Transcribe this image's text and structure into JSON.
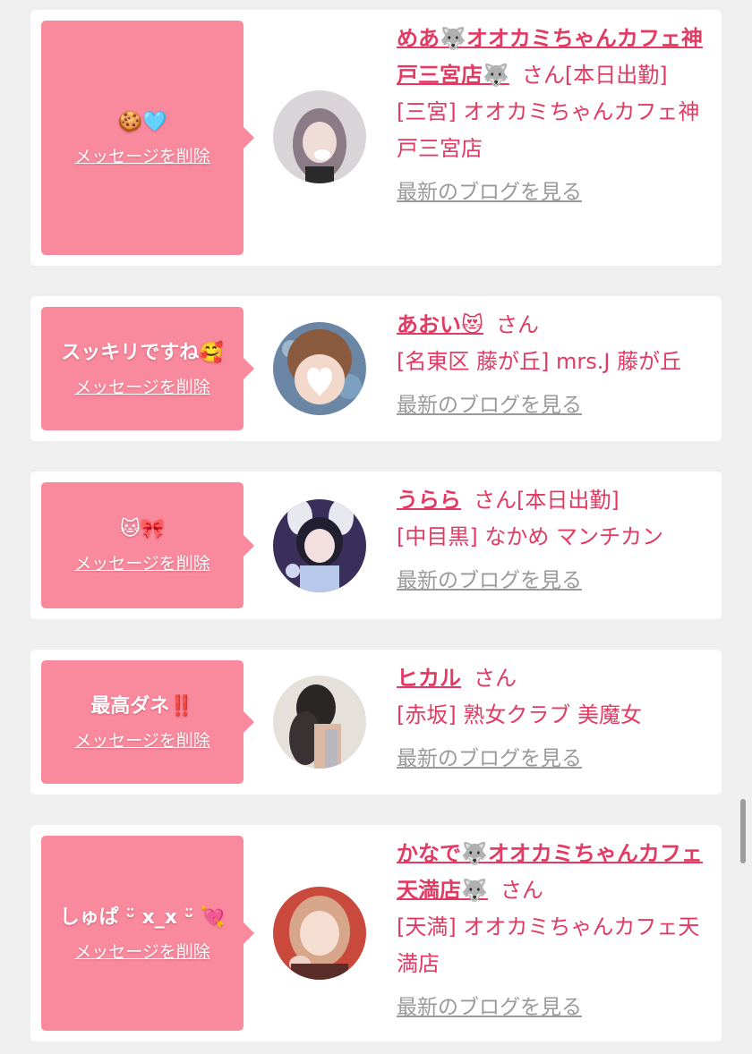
{
  "cards": [
    {
      "message": "🍪🩵",
      "delete_label": "メッセージを削除",
      "name": "めあ🐺オオカミちゃんカフェ神戸三宮店🐺",
      "honorific": "さん",
      "status": "[本日出勤]",
      "shop": "[三宮] オオカミちゃんカフェ神戸三宮店",
      "blog_link": "最新のブログを見る"
    },
    {
      "message": "スッキリですね🥰",
      "delete_label": "メッセージを削除",
      "name": "あおい😻",
      "honorific": "さん",
      "status": "",
      "shop": "[名東区 藤が丘] mrs.J 藤が丘",
      "blog_link": "最新のブログを見る"
    },
    {
      "message": "🐱🎀",
      "delete_label": "メッセージを削除",
      "name": "うらら",
      "honorific": "さん",
      "status": "[本日出勤]",
      "shop": "[中目黒] なかめ マンチカン",
      "blog_link": "最新のブログを見る"
    },
    {
      "message": "最高ダネ‼️",
      "delete_label": "メッセージを削除",
      "name": "ヒカル",
      "honorific": "さん",
      "status": "",
      "shop": "[赤坂] 熟女クラブ 美魔女",
      "blog_link": "最新のブログを見る"
    },
    {
      "message": "しゅぱ ᵕ̈ x_x ᵕ̈ 💘",
      "delete_label": "メッセージを削除",
      "name": "かなで🐺オオカミちゃんカフェ天満店🐺",
      "honorific": "さん",
      "status": "",
      "shop": "[天満] オオカミちゃんカフェ天満店",
      "blog_link": "最新のブログを見る"
    }
  ],
  "colors": {
    "accent": "#e23a63",
    "bubble": "#f98a9e",
    "link_gray": "#9a9a9a",
    "background": "#efefef"
  }
}
